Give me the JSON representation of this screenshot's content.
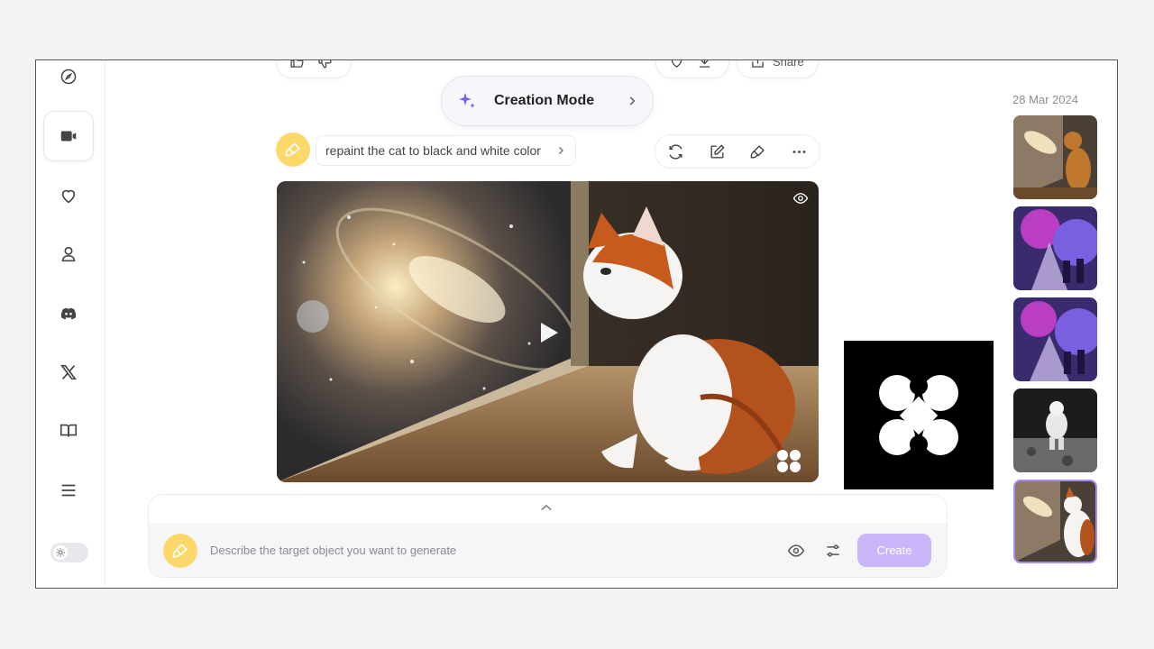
{
  "creation_mode": {
    "label": "Creation Mode"
  },
  "toolbar": {
    "share_label": "Share"
  },
  "prompt": {
    "text": "repaint the cat to black and white color"
  },
  "input": {
    "placeholder": "Describe the target object you want to generate",
    "create_label": "Create"
  },
  "history": {
    "date": "28 Mar 2024",
    "thumbnails": [
      "galaxy-cat",
      "purple-scene",
      "purple-scene-2",
      "astronaut-moon",
      "galaxy-cat-selected"
    ]
  },
  "sidebar": {
    "items": [
      "compass-icon",
      "video-icon",
      "heart-icon",
      "user-icon",
      "discord-icon",
      "x-icon",
      "book-icon",
      "menu-icon"
    ]
  },
  "colors": {
    "accent": "#a78bfa",
    "create_button": "#c9b5f7",
    "brush_avatar": "#fcd86a"
  }
}
